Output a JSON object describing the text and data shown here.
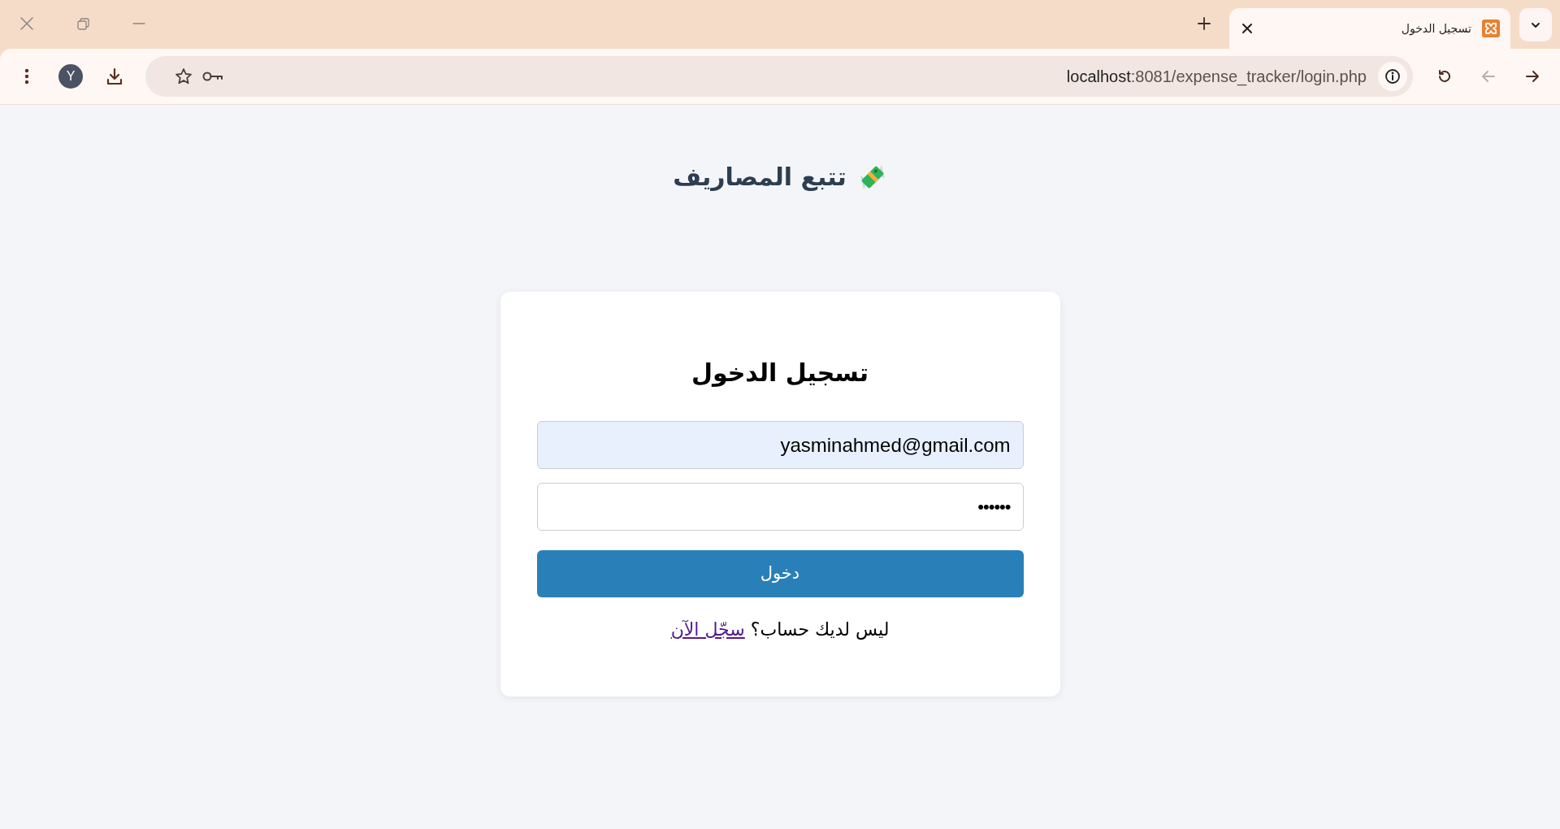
{
  "tab_strip": {
    "tabs": [
      {
        "title": "تسجيل الدخول",
        "selected": true
      }
    ]
  },
  "toolbar": {
    "nav_buttons": [
      {
        "kind": "back",
        "disabled": false
      },
      {
        "kind": "forward",
        "disabled": true
      }
    ],
    "address": {
      "host": "localhost",
      "path": ":8081/expense_tracker/login.php"
    },
    "profile_initial": "Y"
  },
  "page": {
    "title": "تتبع المصاريف",
    "form": {
      "heading": "تسجيل الدخول",
      "fields": [
        {
          "kind": "email",
          "value": "yasminahmed@gmail.com",
          "autofilled": true
        },
        {
          "kind": "password",
          "value": "••••••",
          "autofilled": false
        }
      ],
      "submit": "دخول",
      "signup_prompt": "ليس لديك حساب؟",
      "signup_link": "سجّل الآن"
    }
  }
}
